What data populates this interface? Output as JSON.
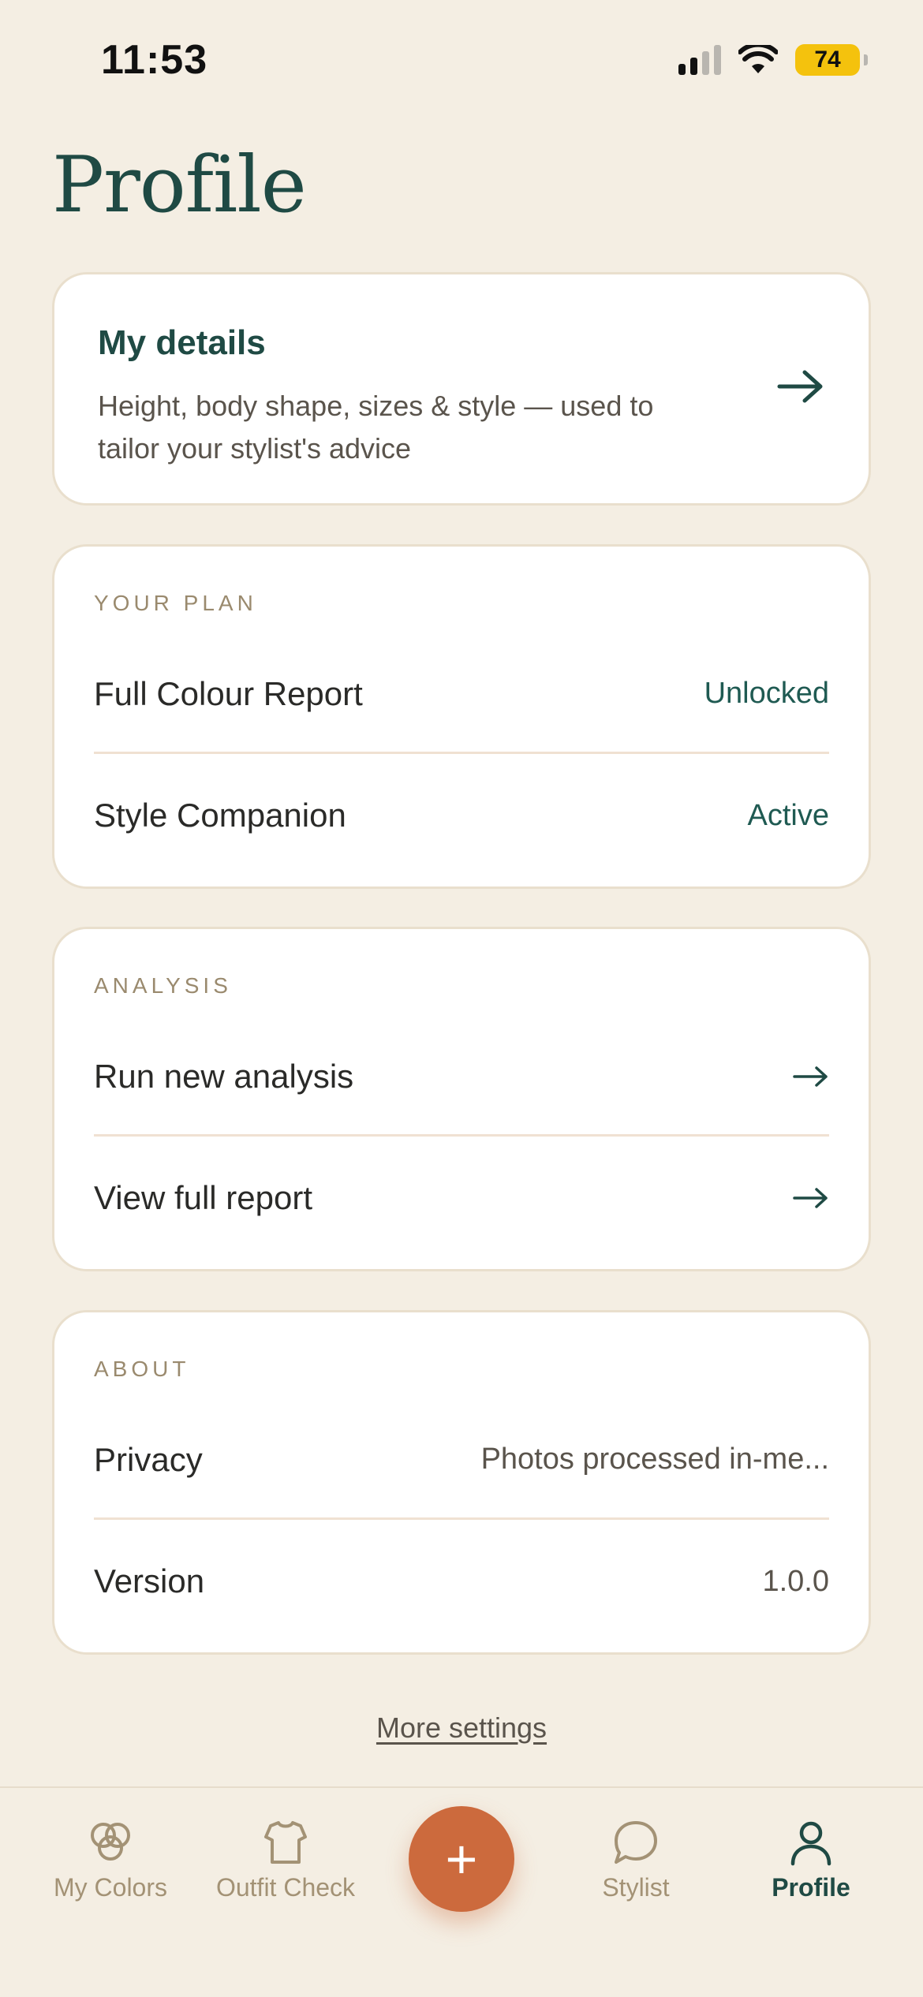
{
  "status_bar": {
    "time": "11:53",
    "battery": "74"
  },
  "header": {
    "title": "Profile"
  },
  "details_card": {
    "title": "My details",
    "description": "Height, body shape, sizes & style — used to tailor your stylist's advice"
  },
  "plan": {
    "label": "YOUR PLAN",
    "rows": [
      {
        "label": "Full Colour Report",
        "value": "Unlocked"
      },
      {
        "label": "Style Companion",
        "value": "Active"
      }
    ]
  },
  "analysis": {
    "label": "ANALYSIS",
    "rows": [
      {
        "label": "Run new analysis"
      },
      {
        "label": "View full report"
      }
    ]
  },
  "about": {
    "label": "ABOUT",
    "rows": [
      {
        "label": "Privacy",
        "value": "Photos processed in-me..."
      },
      {
        "label": "Version",
        "value": "1.0.0"
      }
    ]
  },
  "more_settings": "More settings",
  "tabs": [
    {
      "label": "My Colors",
      "icon": "colors-icon"
    },
    {
      "label": "Outfit Check",
      "icon": "shirt-icon"
    },
    {
      "label": "Stylist",
      "icon": "chat-bubble-icon"
    },
    {
      "label": "Profile",
      "icon": "person-icon",
      "active": true
    }
  ],
  "add_button": {
    "label": "+"
  },
  "colors": {
    "background": "#F4EEE3",
    "primary_green": "#1F4A44",
    "accent_orange": "#CC6A3D",
    "muted_tan": "#A39275"
  }
}
